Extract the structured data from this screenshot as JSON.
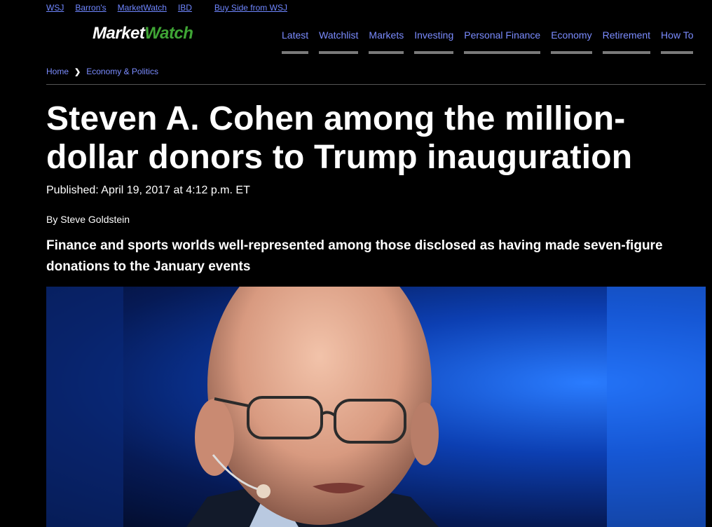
{
  "top_links": [
    "WSJ",
    "Barron's",
    "MarketWatch",
    "IBD",
    "Buy Side from WSJ"
  ],
  "logo": {
    "part1": "Market",
    "part2": "Watch"
  },
  "nav": [
    "Latest",
    "Watchlist",
    "Markets",
    "Investing",
    "Personal Finance",
    "Economy",
    "Retirement",
    "How To"
  ],
  "breadcrumb": {
    "home": "Home",
    "section": "Economy & Politics"
  },
  "article": {
    "headline": "Steven A. Cohen among the million-dollar donors to Trump inauguration",
    "published": "Published: April 19, 2017 at 4:12 p.m. ET",
    "byline": "By Steve Goldstein",
    "dek": "Finance and sports worlds well-represented among those disclosed as having made seven-figure donations to the January events"
  },
  "colors": {
    "link": "#7b8cff",
    "logo_watch": "#3fa535",
    "background": "#000000"
  }
}
